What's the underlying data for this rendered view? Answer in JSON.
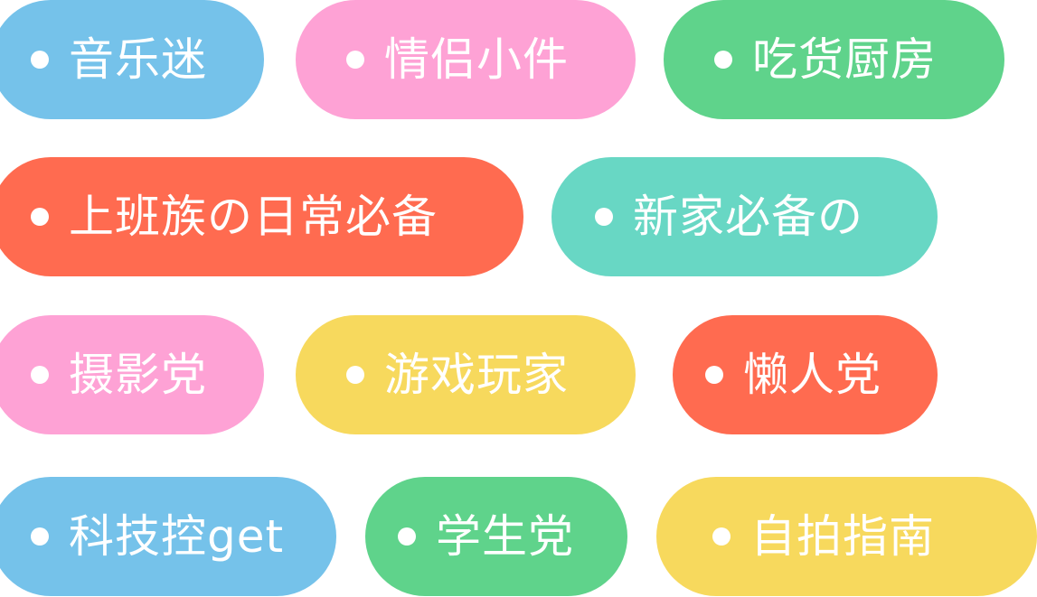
{
  "colors": {
    "blue": "#75c2ea",
    "pink": "#fea2d5",
    "green": "#5fd38b",
    "red": "#ff6b50",
    "teal": "#68d7c4",
    "yellow": "#f7d95d"
  },
  "tags": [
    {
      "label": "音乐迷",
      "color": "blue"
    },
    {
      "label": "情侣小件",
      "color": "pink"
    },
    {
      "label": "吃货厨房",
      "color": "green"
    },
    {
      "label": "上班族の日常必备",
      "color": "red"
    },
    {
      "label": "新家必备の",
      "color": "teal"
    },
    {
      "label": "摄影党",
      "color": "pink"
    },
    {
      "label": "游戏玩家",
      "color": "yellow"
    },
    {
      "label": "懒人党",
      "color": "red"
    },
    {
      "label": "科技控get",
      "color": "blue"
    },
    {
      "label": "学生党",
      "color": "green"
    },
    {
      "label": "自拍指南",
      "color": "yellow"
    }
  ]
}
